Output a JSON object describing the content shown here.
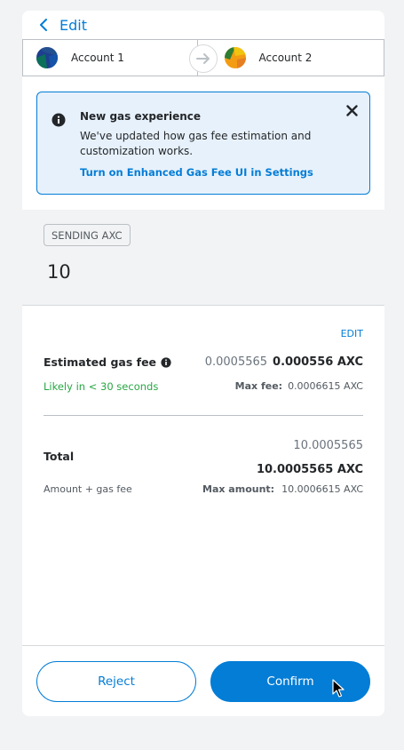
{
  "header": {
    "back_label": "Edit"
  },
  "accounts": {
    "from": "Account 1",
    "to": "Account 2"
  },
  "notice": {
    "title": "New gas experience",
    "body": "We've updated how gas fee estimation and customization works.",
    "link": "Turn on Enhanced Gas Fee UI in Settings"
  },
  "sending": {
    "badge": "SENDING AXC",
    "amount": "10"
  },
  "gas": {
    "edit_label": "EDIT",
    "label": "Estimated gas fee",
    "value_light": "0.0005565",
    "value_bold": "0.000556 AXC",
    "likely": "Likely in < 30 seconds",
    "max_fee_key": "Max fee:",
    "max_fee_value": "0.0006615 AXC"
  },
  "total": {
    "label": "Total",
    "value_light": "10.0005565",
    "value_bold": "10.0005565 AXC",
    "sublabel": "Amount + gas fee",
    "max_amount_key": "Max amount:",
    "max_amount_value": "10.0006615 AXC"
  },
  "buttons": {
    "reject": "Reject",
    "confirm": "Confirm"
  },
  "colors": {
    "accent": "#037dd6",
    "success": "#28a745",
    "notice_bg": "#e7f1fb"
  }
}
